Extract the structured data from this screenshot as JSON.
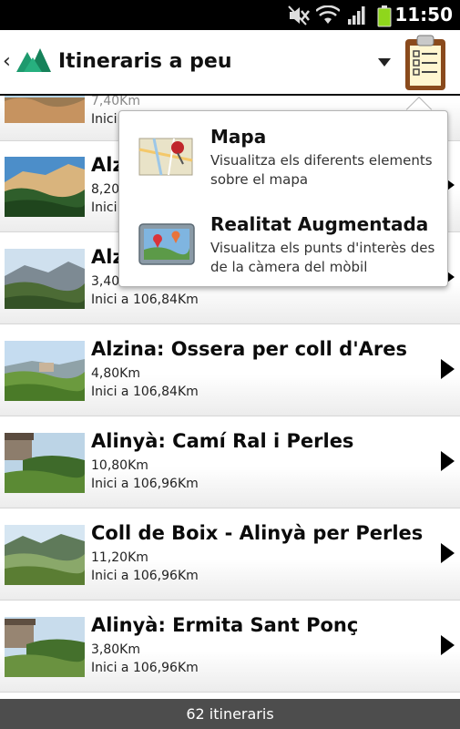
{
  "status_bar": {
    "time": "11:50"
  },
  "header": {
    "title": "Itineraris a peu"
  },
  "partial_row": {
    "distance": "7,40Km",
    "start": "Inici"
  },
  "rows": [
    {
      "title": "Alzi",
      "distance": "8,20",
      "start": "Inici"
    },
    {
      "title": "Alzi",
      "distance": "3,40",
      "start": "Inici a 106,84Km"
    },
    {
      "title": "Alzina: Ossera per coll d'Ares",
      "distance": "4,80Km",
      "start": "Inici a 106,84Km"
    },
    {
      "title": "Alinyà: Camí Ral i Perles",
      "distance": "10,80Km",
      "start": "Inici a 106,96Km"
    },
    {
      "title": "Coll de Boix - Alinyà per Perles",
      "distance": "11,20Km",
      "start": "Inici a 106,96Km"
    },
    {
      "title": "Alinyà: Ermita Sant Ponç",
      "distance": "3,80Km",
      "start": "Inici a 106,96Km"
    }
  ],
  "popup": {
    "items": [
      {
        "title": "Mapa",
        "description": "Visualitza els diferents elements sobre el mapa",
        "icon": "map-pin-icon"
      },
      {
        "title": "Realitat Augmentada",
        "description": "Visualitza els punts d'interès des de la càmera del mòbil",
        "icon": "augmented-reality-icon"
      }
    ]
  },
  "footer": {
    "count_label": "62 itineraris"
  },
  "colors": {
    "footer_bg": "#4d4d4d",
    "brand_green": "#1e9a6e"
  }
}
